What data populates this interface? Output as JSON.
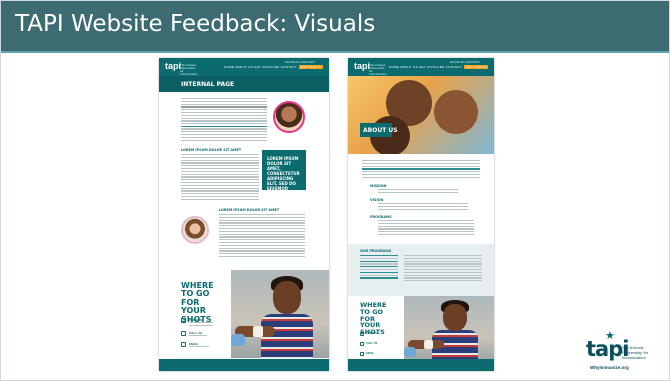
{
  "slide": {
    "title": "TAPI Website Feedback: Visuals"
  },
  "left_mockup": {
    "logo": "tapi",
    "logo_tagline": "The Arizona Partnership for Immunization",
    "nav_top": "FAQ  BLOG  CONTACT",
    "nav_links": "HOME  ABOUT US  GET INVOLVED  CONTACT",
    "nav_button": "GET SHOTS",
    "band_title": "INTERNAL PAGE",
    "section_head_1": "LOREM IPSUM DOLOR SIT AMET",
    "callout": "LOREM IPSUM DOLOR SIT AMET, CONSECTETUR ADIPISCING ELIT, SED DO EIUSMOD TEMPOR INCIDIDUNT UT LABORE ET",
    "section_head_2": "LOREM IPSUM DOLOR SIT AMET",
    "shots_title": "WHERE TO GO FOR YOUR SHOTS",
    "shot_items": [
      "ADDRESS",
      "CALL US",
      "EMAIL"
    ]
  },
  "right_mockup": {
    "logo": "tapi",
    "logo_tagline": "The Arizona Partnership for Immunization",
    "nav_top": "FAQ  BLOG  CONTACT",
    "nav_links": "HOME  ABOUT US  GET INVOLVED  CONTACT",
    "nav_button": "GET SHOTS",
    "hero_title": "ABOUT US",
    "section_heads": [
      "MISSION",
      "VISION",
      "PROGRAMS"
    ],
    "panel_head": "OUR PROGRAMS",
    "shots_title": "WHERE TO GO FOR YOUR SHOTS",
    "shot_items": [
      "ADDRESS",
      "CALL US",
      "EMAIL"
    ]
  },
  "brand": {
    "logo_word": "tapi",
    "logo_tagline": "The Arizona Partnership for Immunization",
    "url": "WhyImmunize.org",
    "colors": {
      "title_bar": "#3d6b72",
      "teal": "#0b6b6f",
      "accent": "#f4a020"
    }
  }
}
